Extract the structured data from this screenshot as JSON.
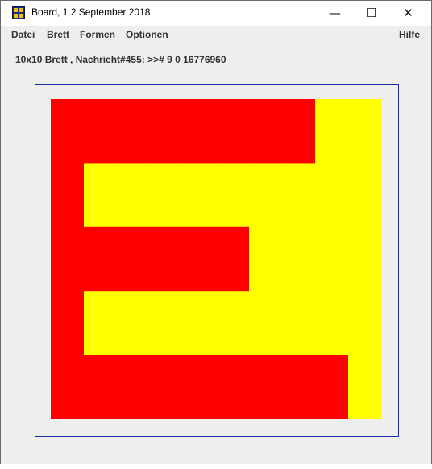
{
  "window": {
    "title": "Board, 1.2 September 2018",
    "controls": {
      "minimize_glyph": "—",
      "maximize_glyph": "☐",
      "close_glyph": "✕"
    },
    "app_icon": "board-app-icon"
  },
  "menu": {
    "datei": "Datei",
    "brett": "Brett",
    "formen": "Formen",
    "optionen": "Optionen",
    "hilfe": "Hilfe"
  },
  "status": {
    "text": "10x10 Brett , Nachricht#455: >># 9 0 16776960"
  },
  "board": {
    "rows": 10,
    "cols": 10,
    "colors": {
      "R": "#ff0000",
      "Y": "#ffff00"
    },
    "cells": [
      "RRRRRRRRYY",
      "RRRRRRRRYY",
      "RYYYYYYYYY",
      "RYYYYYYYYY",
      "RRRRRRYYYY",
      "RRRRRRYYYY",
      "RYYYYYYYYY",
      "RYYYYYYYYY",
      "RRRRRRRRRY",
      "RRRRRRRRRY"
    ]
  }
}
